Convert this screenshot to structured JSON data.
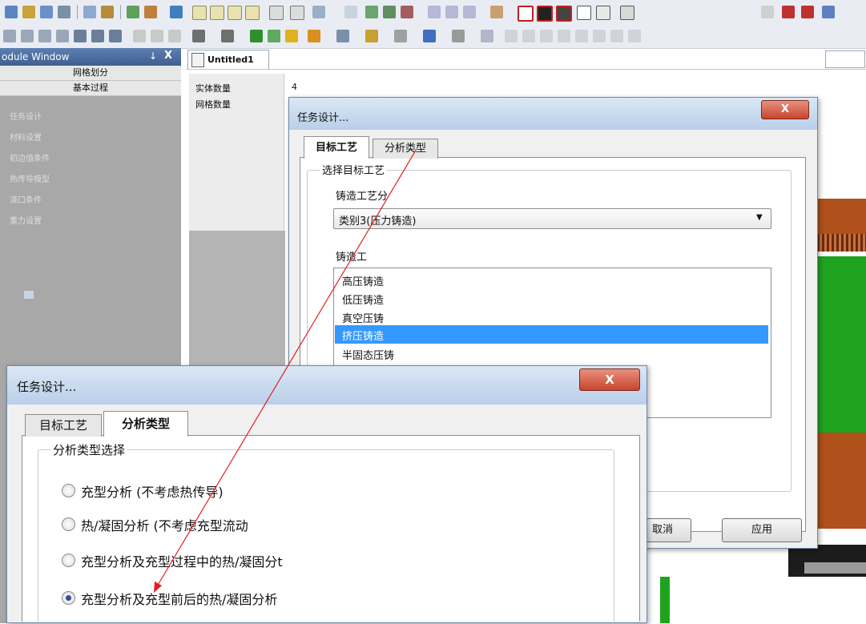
{
  "module_window": {
    "title": "odule Window",
    "pin_icon": "pin-icon",
    "close_label": "X",
    "tabs": [
      "网格划分",
      "基本过程"
    ],
    "items": [
      "任务设计",
      "材料设置",
      "初边值条件",
      "热传导模型",
      "浇口条件",
      "重力设置"
    ]
  },
  "document_tab": {
    "label": "Untitled1"
  },
  "properties": {
    "rows": [
      {
        "label": "实体数量",
        "value": "4"
      },
      {
        "label": "网格数量",
        "value": ""
      }
    ]
  },
  "dialog_back": {
    "title": "任务设计...",
    "close_label": "X",
    "tabs": [
      "目标工艺",
      "分析类型"
    ],
    "active_tab": "目标工艺",
    "group_label": "选择目标工艺",
    "casting_class_label": "铸造工艺分",
    "casting_class_value": "类别3(压力铸造)",
    "casting_list_label": "铸造工",
    "casting_options": [
      "高压铸造",
      "低压铸造",
      "真空压铸",
      "挤压铸造",
      "半固态压铸"
    ],
    "selected_option": "挤压铸造",
    "buttons": [
      "取消",
      "应用"
    ]
  },
  "dialog_front": {
    "title": "任务设计...",
    "close_label": "X",
    "tabs": [
      "目标工艺",
      "分析类型"
    ],
    "active_tab": "分析类型",
    "group_label": "分析类型选择",
    "options": [
      "充型分析 (不考虑热传导)",
      "热/凝固分析 (不考虑充型流动",
      "充型分析及充型过程中的热/凝固分t",
      "充型分析及充型前后的热/凝固分析"
    ],
    "selected_index": 3
  },
  "colors": {
    "title_bar": "#3f5f91",
    "selection": "#3399ff",
    "annotation_arrow": "#e02020",
    "model_green": "#1fa31f",
    "model_brown": "#b0501a"
  }
}
